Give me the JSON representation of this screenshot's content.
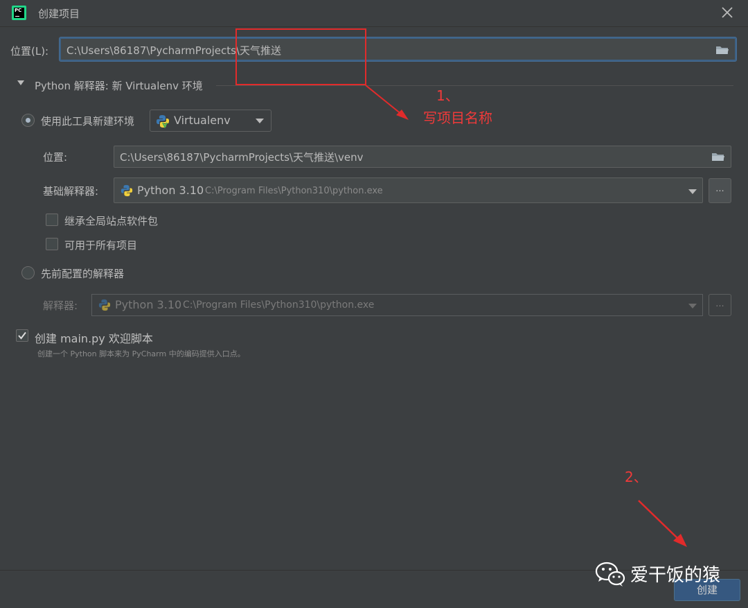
{
  "window": {
    "title": "创建项目",
    "close_icon": "close-icon"
  },
  "location": {
    "label": "位置(L):",
    "value": "C:\\Users\\86187\\PycharmProjects\\天气推送"
  },
  "interpreter_section": {
    "title": "Python 解释器: 新 Virtualenv 环境",
    "new_env": {
      "radio_label": "使用此工具新建环境",
      "selected": true,
      "tool": "Virtualenv",
      "location_label": "位置:",
      "location_value": "C:\\Users\\86187\\PycharmProjects\\天气推送\\venv",
      "base_label": "基础解释器:",
      "base_name": "Python 3.10",
      "base_path": "C:\\Program Files\\Python310\\python.exe",
      "inherit_label": "继承全局站点软件包",
      "inherit_checked": false,
      "all_projects_label": "可用于所有项目",
      "all_projects_checked": false
    },
    "existing": {
      "radio_label": "先前配置的解释器",
      "selected": false,
      "interpreter_label": "解释器:",
      "interpreter_name": "Python 3.10",
      "interpreter_path": "C:\\Program Files\\Python310\\python.exe"
    }
  },
  "main_script": {
    "label": "创建 main.py 欢迎脚本",
    "checked": true,
    "hint": "创建一个 Python 脚本来为 PyCharm 中的编码提供入口点。"
  },
  "buttons": {
    "dots": "...",
    "create": "创建"
  },
  "annotations": {
    "step1_number": "1、",
    "step1_text": "写项目名称",
    "step2_number": "2、",
    "color": "#e22b2b"
  },
  "watermark": {
    "text": "爱干饭的猿"
  },
  "colors": {
    "background": "#3c3f41",
    "field": "#45494a",
    "accent_button": "#365880"
  }
}
